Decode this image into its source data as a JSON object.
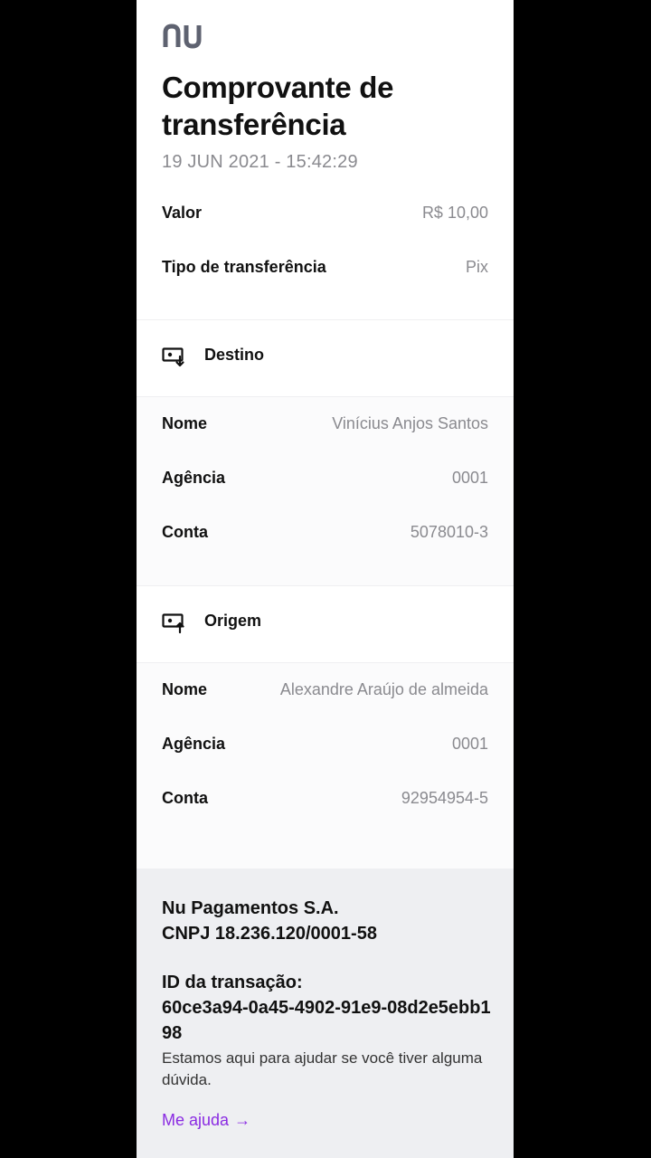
{
  "header": {
    "logo_text": "nu",
    "title": "Comprovante de transferência",
    "timestamp": "19 JUN 2021 - 15:42:29"
  },
  "summary": [
    {
      "label": "Valor",
      "value": "R$ 10,00"
    },
    {
      "label": "Tipo de transferência",
      "value": "Pix"
    }
  ],
  "destino": {
    "title": "Destino",
    "icon": "bank-transfer-in-icon",
    "rows": [
      {
        "label": "Nome",
        "value": "Vinícius Anjos Santos"
      },
      {
        "label": "Agência",
        "value": "0001"
      },
      {
        "label": "Conta",
        "value": "5078010-3"
      }
    ]
  },
  "origem": {
    "title": "Origem",
    "icon": "bank-transfer-out-icon",
    "rows": [
      {
        "label": "Nome",
        "value": "Alexandre Araújo de almeida"
      },
      {
        "label": "Agência",
        "value": "0001"
      },
      {
        "label": "Conta",
        "value": "92954954-5"
      }
    ]
  },
  "footer": {
    "company_name": "Nu Pagamentos S.A.",
    "cnpj": "CNPJ 18.236.120/0001-58",
    "transaction_label": "ID da transação:",
    "transaction_id": "60ce3a94-0a45-4902-91e9-08d2e5ebb198",
    "help_text": "Estamos aqui para ajudar se você tiver alguma dúvida.",
    "help_link": "Me ajuda",
    "help_link_arrow": "→"
  },
  "colors": {
    "brand": "#8a2be2",
    "muted": "#8a8a8f",
    "footer_bg": "#eeeff2"
  }
}
